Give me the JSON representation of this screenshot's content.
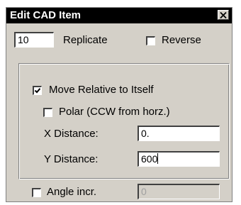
{
  "dialog": {
    "title": "Edit CAD Item",
    "close_glyph": "close-icon"
  },
  "replicate": {
    "value": "10",
    "label": "Replicate"
  },
  "reverse": {
    "label": "Reverse",
    "checked": false
  },
  "group": {
    "move_relative": {
      "label": "Move Relative to Itself",
      "checked": true
    },
    "polar": {
      "label": "Polar (CCW from horz.)",
      "checked": false
    },
    "x_distance": {
      "label": "X Distance:",
      "value": "0."
    },
    "y_distance": {
      "label": "Y Distance:",
      "value": "600"
    }
  },
  "angle_incr": {
    "label": "Angle incr.",
    "checked": false,
    "value": "0"
  }
}
